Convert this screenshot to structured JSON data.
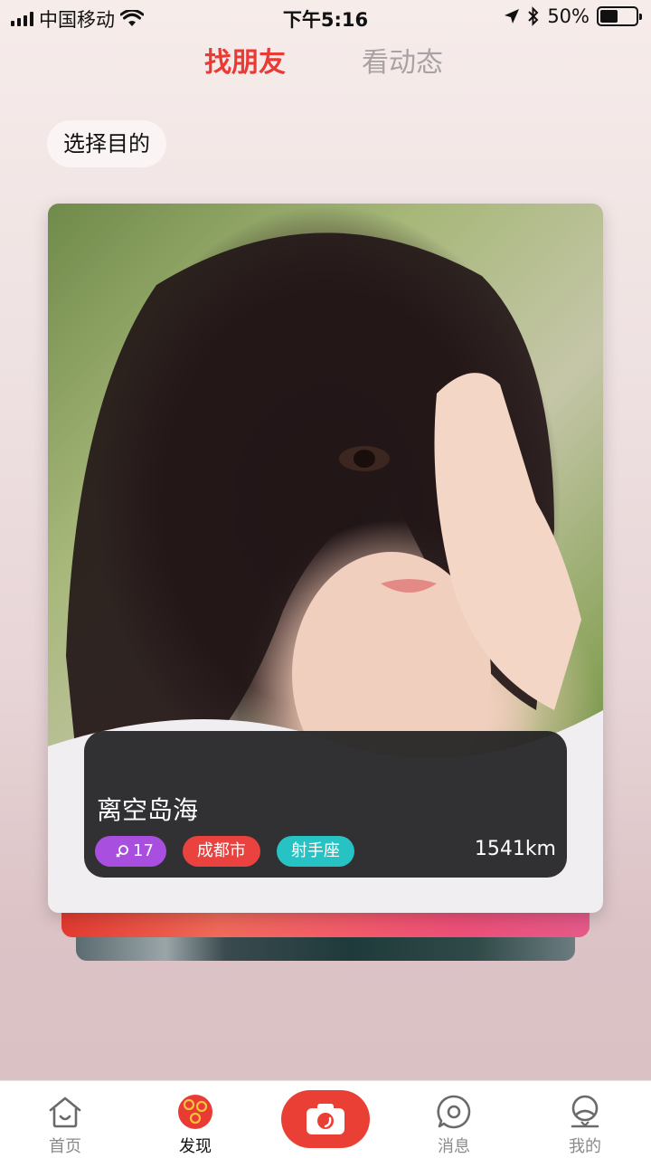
{
  "status_bar": {
    "carrier": "中国移动",
    "time": "下午5:16",
    "battery_percent": "50%",
    "battery_level": 0.5
  },
  "tabs": [
    {
      "label": "找朋友",
      "active": true
    },
    {
      "label": "看动态",
      "active": false
    }
  ],
  "purpose_filter": {
    "label": "选择目的"
  },
  "card": {
    "name": "离空岛海",
    "age": "17",
    "city": "成都市",
    "zodiac": "射手座",
    "distance": "1541km"
  },
  "bottom_nav": [
    {
      "label": "首页",
      "icon": "home-icon"
    },
    {
      "label": "发现",
      "icon": "discover-icon"
    },
    {
      "label": "",
      "icon": "camera-icon"
    },
    {
      "label": "消息",
      "icon": "message-icon"
    },
    {
      "label": "我的",
      "icon": "profile-icon"
    }
  ],
  "colors": {
    "accent": "#ea3a34",
    "tag_age": "#a94fe0",
    "tag_city": "#e9423f",
    "tag_zodiac": "#27c2c4"
  }
}
